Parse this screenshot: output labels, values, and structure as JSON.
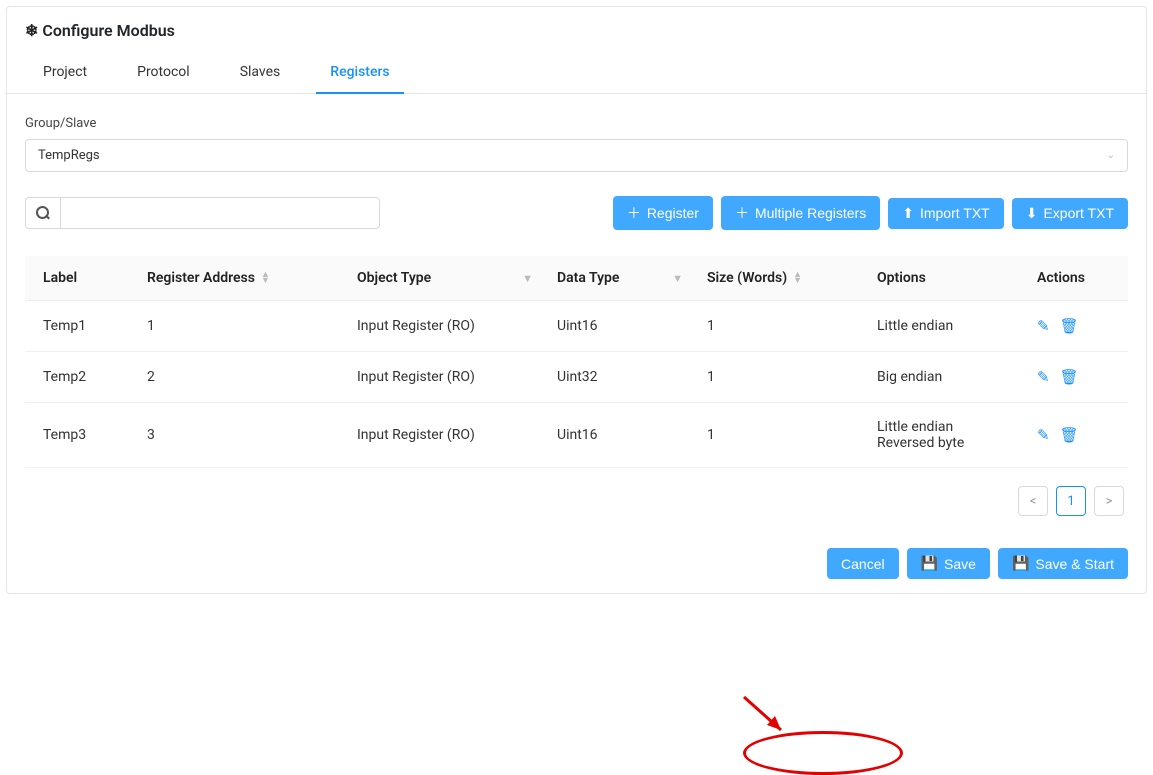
{
  "header": {
    "title": "Configure Modbus"
  },
  "tabs": [
    {
      "label": "Project",
      "active": false
    },
    {
      "label": "Protocol",
      "active": false
    },
    {
      "label": "Slaves",
      "active": false
    },
    {
      "label": "Registers",
      "active": true
    }
  ],
  "group_slave": {
    "label": "Group/Slave",
    "value": "TempRegs"
  },
  "search": {
    "value": ""
  },
  "actions": {
    "register": "Register",
    "multiple_registers": "Multiple Registers",
    "import_txt": "Import TXT",
    "export_txt": "Export TXT"
  },
  "columns": {
    "label": "Label",
    "register_address": "Register Address",
    "object_type": "Object Type",
    "data_type": "Data Type",
    "size": "Size (Words)",
    "options": "Options",
    "actions": "Actions"
  },
  "rows": [
    {
      "label": "Temp1",
      "address": "1",
      "object_type": "Input Register (RO)",
      "data_type": "Uint16",
      "size": "1",
      "options": "Little endian"
    },
    {
      "label": "Temp2",
      "address": "2",
      "object_type": "Input Register (RO)",
      "data_type": "Uint32",
      "size": "1",
      "options": "Big endian"
    },
    {
      "label": "Temp3",
      "address": "3",
      "object_type": "Input Register (RO)",
      "data_type": "Uint16",
      "size": "1",
      "options": "Little endian\nReversed byte"
    }
  ],
  "pagination": {
    "current": "1"
  },
  "footer": {
    "cancel": "Cancel",
    "save": "Save",
    "save_start": "Save & Start"
  }
}
